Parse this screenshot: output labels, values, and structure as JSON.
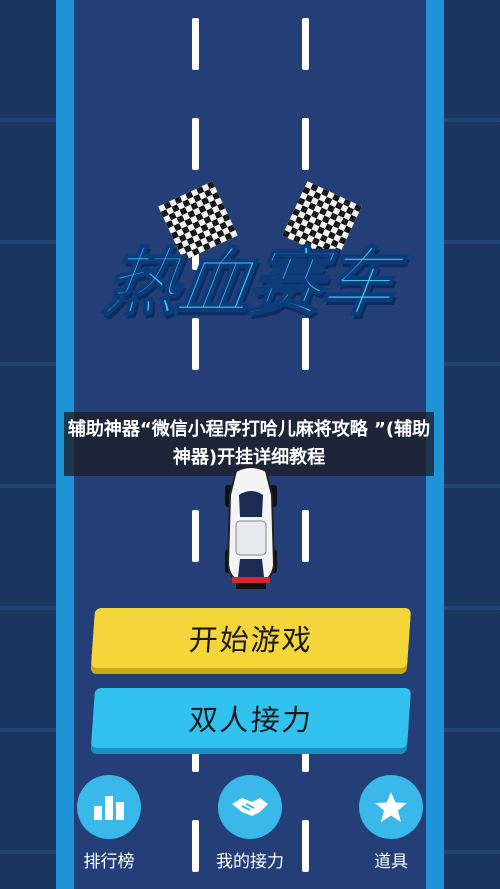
{
  "game": {
    "title": "热血赛车"
  },
  "overlay": {
    "banner_text": "辅助神器“微信小程序打哈儿麻将攻略 ”(辅助神器)开挂详细教程"
  },
  "menu": {
    "start_label": "开始游戏",
    "relay_label": "双人接力"
  },
  "bottom_nav": {
    "items": [
      {
        "label": "排行榜",
        "icon": "leaderboard-icon"
      },
      {
        "label": "我的接力",
        "icon": "handshake-icon"
      },
      {
        "label": "道具",
        "icon": "star-icon"
      }
    ]
  },
  "colors": {
    "road": "#243f78",
    "kerb": "#1f93d8",
    "start_button": "#f5d63a",
    "relay_button": "#31c2ef",
    "nav_circle": "#3ab8ea",
    "title": "#3fc8f5"
  }
}
